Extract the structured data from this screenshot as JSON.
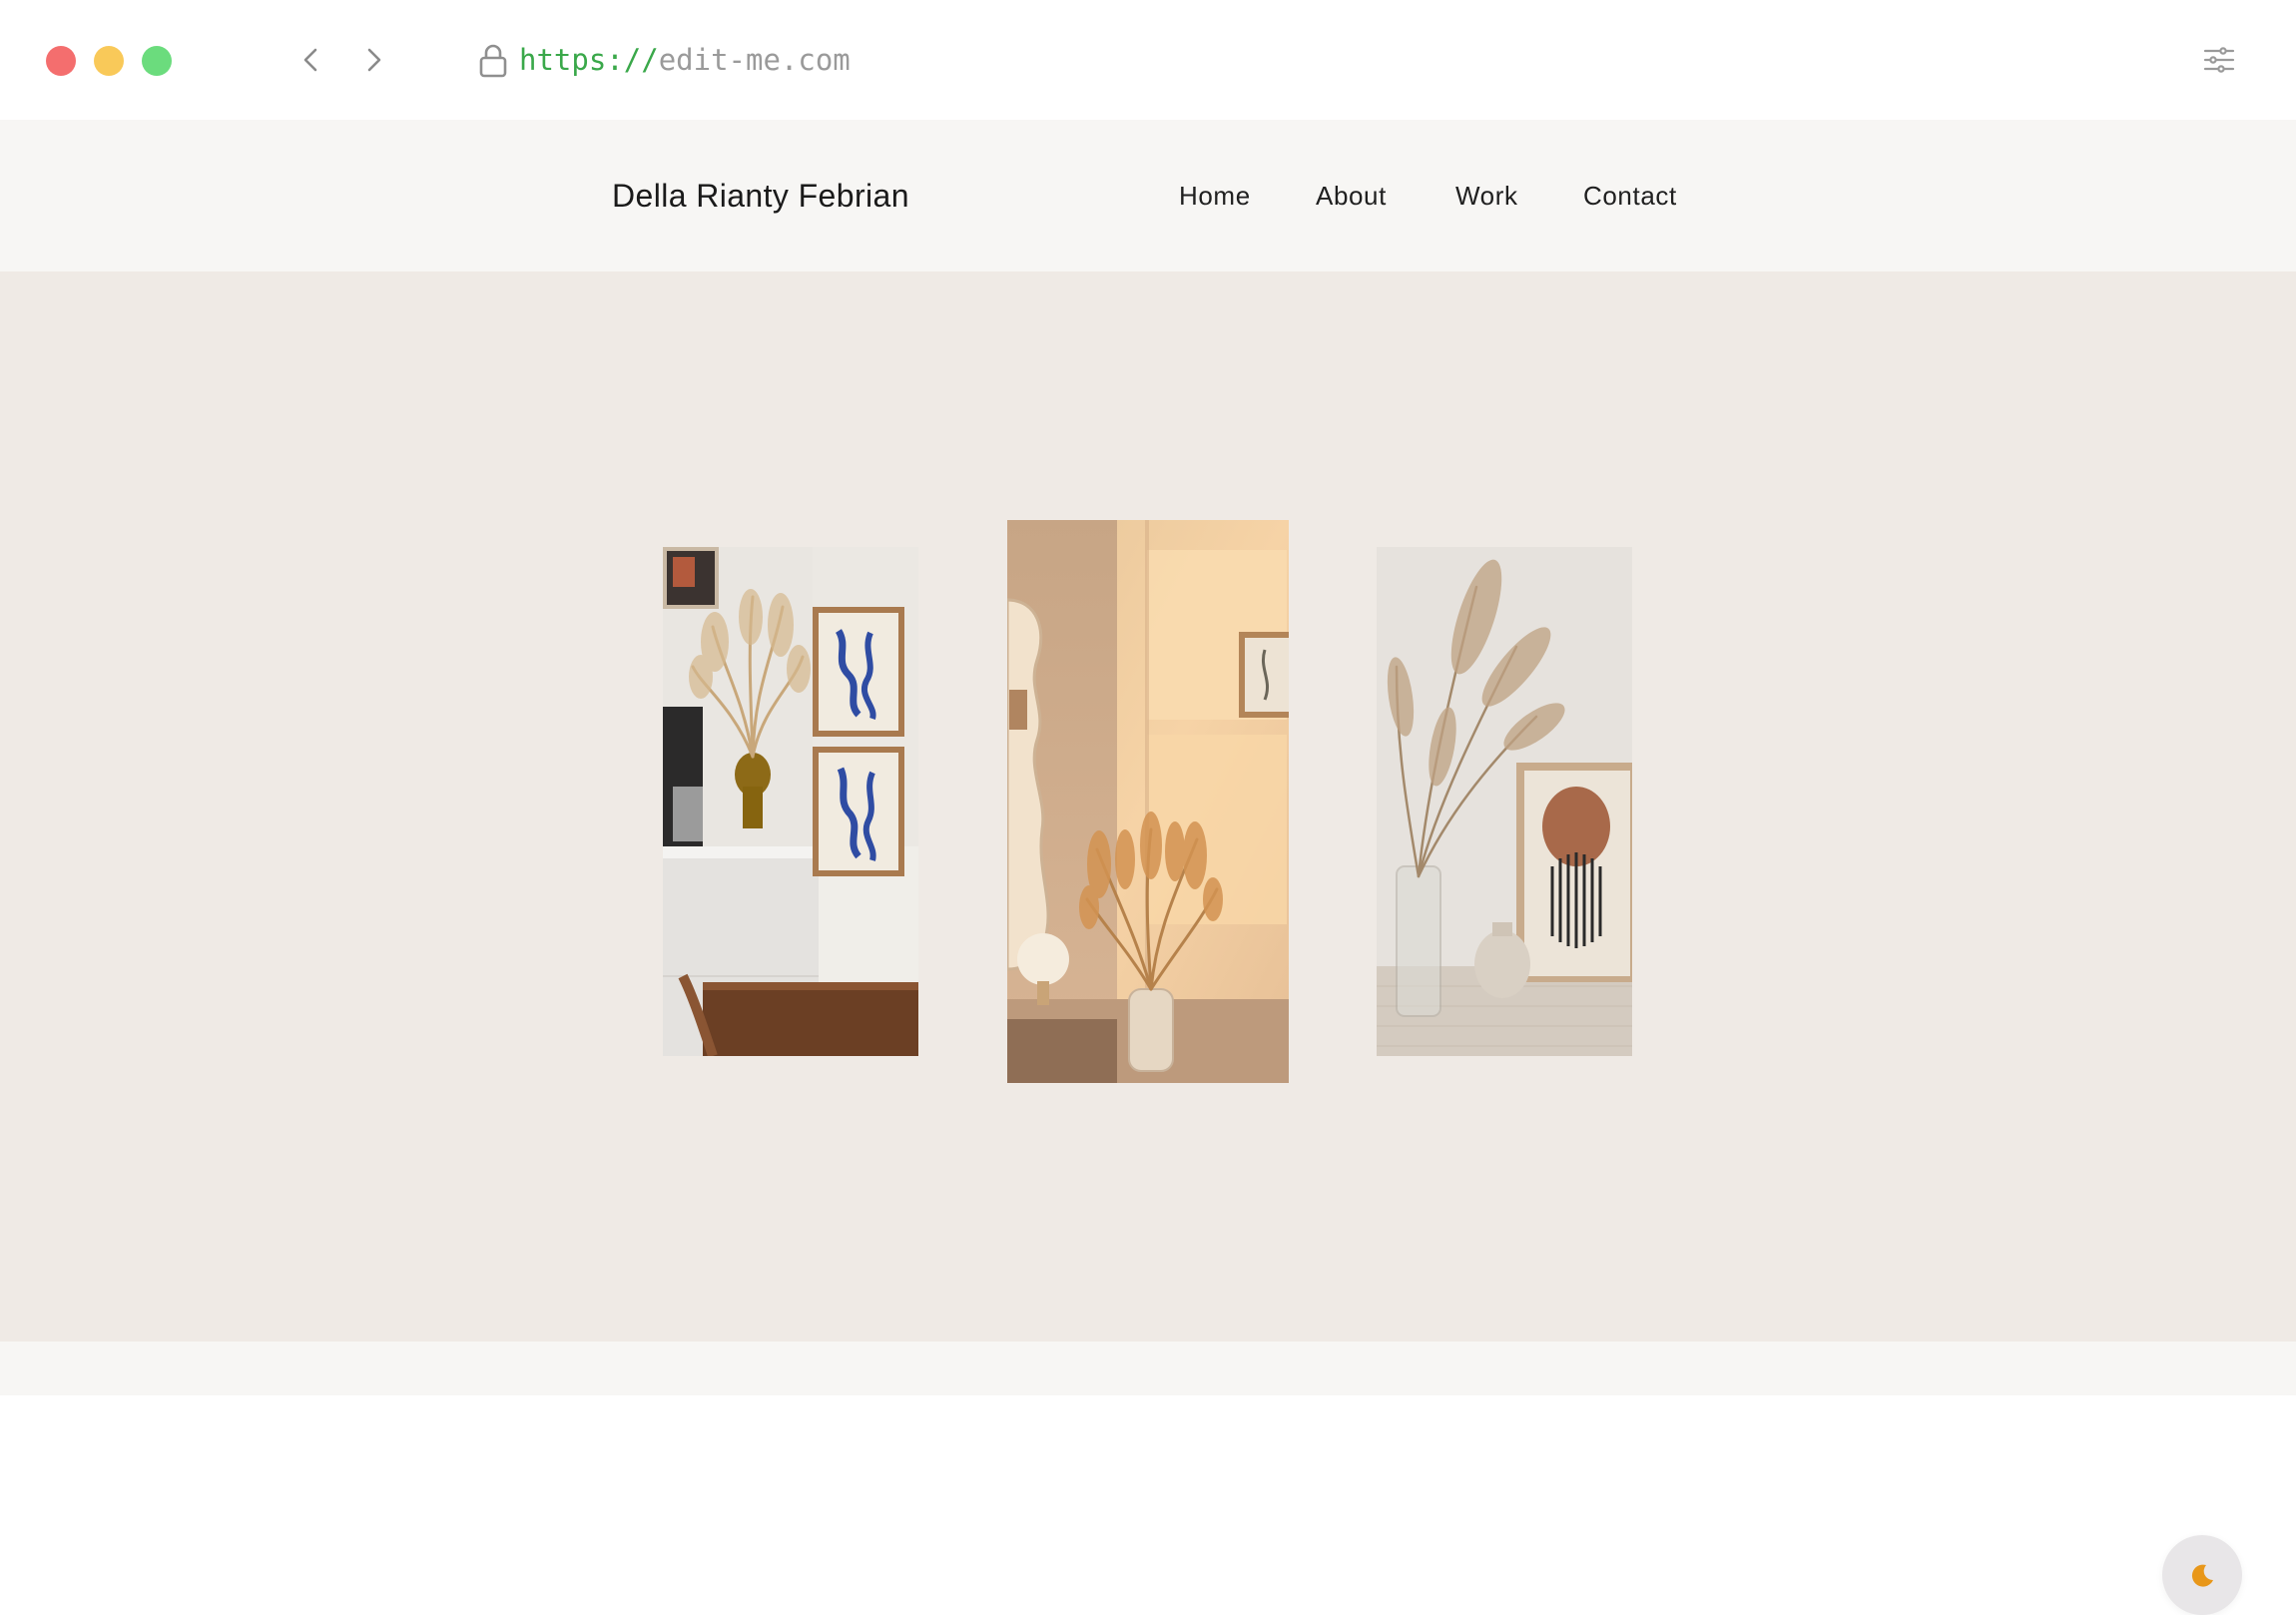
{
  "browser": {
    "url_scheme": "https://",
    "url_host": "edit-me.com",
    "traffic_lights": {
      "close": "#f46e6e",
      "minimize": "#f9c959",
      "maximize": "#6bdc7d"
    },
    "icons": [
      "chevron-left-icon",
      "chevron-right-icon",
      "lock-icon",
      "sliders-icon"
    ]
  },
  "site": {
    "brand": "Della Rianty Febrian",
    "nav": [
      {
        "label": "Home"
      },
      {
        "label": "About"
      },
      {
        "label": "Work"
      },
      {
        "label": "Contact"
      }
    ]
  },
  "hero": {
    "photos": [
      "dried-pampas-vase-with-blue-art-prints",
      "pampas-in-sunlit-corner-with-mirror",
      "pampas-in-glass-vase-with-abstract-print"
    ],
    "theme_toggle_icon": "moon-icon",
    "accent": "#e8971a"
  },
  "colors": {
    "header_bg": "#f7f6f4",
    "hero_bg": "#efeae5",
    "url_scheme": "#3aa84a",
    "url_host": "#9a9a9a"
  }
}
